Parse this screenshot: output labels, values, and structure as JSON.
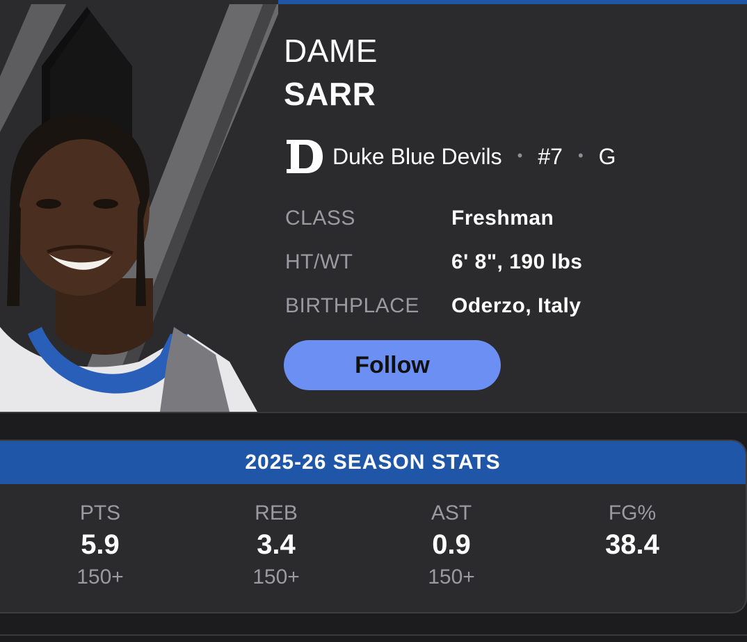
{
  "player": {
    "first_name": "DAME",
    "last_name": "SARR"
  },
  "team": {
    "logo_icon": "duke-d-logo",
    "name": "Duke Blue Devils",
    "number": "#7",
    "position": "G",
    "separator": "•"
  },
  "info": [
    {
      "label": "CLASS",
      "value": "Freshman"
    },
    {
      "label": "HT/WT",
      "value": "6' 8\", 190 lbs"
    },
    {
      "label": "BIRTHPLACE",
      "value": "Oderzo, Italy"
    }
  ],
  "follow_label": "Follow",
  "stats": {
    "title": "2025-26 SEASON STATS",
    "columns": [
      {
        "label": "PTS",
        "value": "5.9",
        "rank": "150+"
      },
      {
        "label": "REB",
        "value": "3.4",
        "rank": "150+"
      },
      {
        "label": "AST",
        "value": "0.9",
        "rank": "150+"
      },
      {
        "label": "FG%",
        "value": "38.4",
        "rank": ""
      }
    ]
  },
  "colors": {
    "accent_blue": "#1f56a8",
    "follow_button": "#6b8ff2",
    "card_bg": "#2b2b2d",
    "label_gray": "#9a9aa0"
  }
}
